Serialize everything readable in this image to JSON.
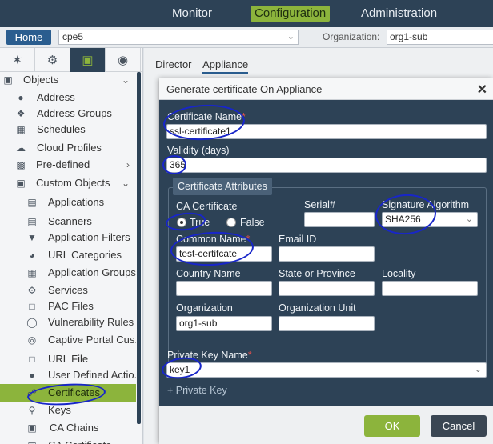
{
  "topnav": {
    "tabs": [
      {
        "label": "Monitor"
      },
      {
        "label": "Configuration"
      },
      {
        "label": "Administration"
      }
    ]
  },
  "bar": {
    "home_label": "Home",
    "device_value": "cpe5",
    "org_label": "Organization:",
    "org_value": "org1-sub"
  },
  "sidebar": {
    "icon_tabs": [
      "topology-icon",
      "gear-icon",
      "cube-icon",
      "globe-settings-icon"
    ],
    "items": [
      {
        "label": "Objects",
        "icon": "cube-icon"
      },
      {
        "label": "Address",
        "icon": "pin-icon"
      },
      {
        "label": "Address Groups",
        "icon": "pin-group-icon"
      },
      {
        "label": "Schedules",
        "icon": "calendar-icon"
      },
      {
        "label": "Cloud Profiles",
        "icon": "cloud-icon"
      },
      {
        "label": "Pre-defined",
        "icon": "predefined-icon"
      },
      {
        "label": "Custom Objects",
        "icon": "custom-objects-icon"
      },
      {
        "label": "Applications",
        "icon": "applications-icon"
      },
      {
        "label": "Scanners",
        "icon": "scanner-icon"
      },
      {
        "label": "Application Filters",
        "icon": "filter-icon"
      },
      {
        "label": "URL Categories",
        "icon": "url-category-icon"
      },
      {
        "label": "Application Groups",
        "icon": "app-group-icon"
      },
      {
        "label": "Services",
        "icon": "services-icon"
      },
      {
        "label": "PAC Files",
        "icon": "file-icon"
      },
      {
        "label": "Vulnerability Rules",
        "icon": "vulnerability-icon"
      },
      {
        "label": "Captive Portal Cus...",
        "icon": "captive-portal-icon"
      },
      {
        "label": "URL File",
        "icon": "url-file-icon"
      },
      {
        "label": "User Defined Actio...",
        "icon": "user-action-icon"
      },
      {
        "label": "Certificates",
        "icon": "certificate-icon"
      },
      {
        "label": "Keys",
        "icon": "key-icon"
      },
      {
        "label": "CA Chains",
        "icon": "ca-chain-icon"
      },
      {
        "label": "CA Certificate",
        "icon": "ca-certificate-icon"
      }
    ]
  },
  "content": {
    "tabs": [
      {
        "label": "Director"
      },
      {
        "label": "Appliance"
      }
    ]
  },
  "modal": {
    "title": "Generate certificate On Appliance",
    "certificate_name_label": "Certificate Name",
    "certificate_name_value": "ssl-certificate1",
    "validity_label": "Validity (days)",
    "validity_value": "365",
    "attributes_title": "Certificate Attributes",
    "ca_certificate_label": "CA Certificate",
    "ca_true_label": "True",
    "ca_false_label": "False",
    "serial_label": "Serial#",
    "serial_value": "",
    "signature_label": "Signature Algorithm",
    "signature_value": "SHA256",
    "common_name_label": "Common Name",
    "common_name_value": "test-certifcate",
    "email_label": "Email ID",
    "email_value": "",
    "country_label": "Country Name",
    "country_value": "",
    "state_label": "State or Province",
    "state_value": "",
    "locality_label": "Locality",
    "locality_value": "",
    "organization_label": "Organization",
    "organization_value": "org1-sub",
    "org_unit_label": "Organization Unit",
    "org_unit_value": "",
    "private_key_label": "Private Key Name",
    "private_key_value": "key1",
    "add_private_key": "+ Private Key",
    "ok_label": "OK",
    "cancel_label": "Cancel",
    "required_mark": "*"
  },
  "colors": {
    "nav_bg": "#2d4256",
    "accent_green": "#8cb43c",
    "home_blue": "#2a5d8f",
    "annotation_blue": "#1826c9",
    "required_red": "#e0504d"
  }
}
